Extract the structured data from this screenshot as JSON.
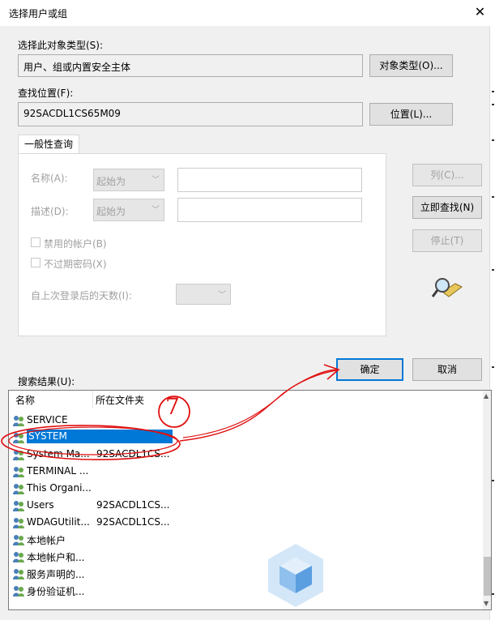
{
  "window": {
    "title": "选择用户或组",
    "close_glyph": "✕"
  },
  "object_type": {
    "label": "选择此对象类型(S):",
    "value": "用户、组或内置安全主体",
    "button": "对象类型(O)..."
  },
  "location": {
    "label": "查找位置(F):",
    "value": "92SACDL1CS65M09",
    "button": "位置(L)..."
  },
  "query": {
    "tab_label": "一般性查询",
    "name_label": "名称(A):",
    "name_mode": "起始为",
    "desc_label": "描述(D):",
    "desc_mode": "起始为",
    "disabled_accounts": "禁用的帐户(B)",
    "non_expiring_pw": "不过期密码(X)",
    "days_since_logon": "自上次登录后的天数(I):"
  },
  "side_buttons": {
    "columns": "列(C)...",
    "find_now": "立即查找(N)",
    "stop": "停止(T)"
  },
  "dialog_buttons": {
    "ok": "确定",
    "cancel": "取消"
  },
  "results": {
    "label": "搜索结果(U):",
    "col_name": "名称",
    "col_folder": "所在文件夹",
    "rows": [
      {
        "name": "SERVICE",
        "folder": ""
      },
      {
        "name": "SYSTEM",
        "folder": "",
        "selected": true
      },
      {
        "name": "System Ma...",
        "folder": "92SACDL1CS..."
      },
      {
        "name": "TERMINAL ...",
        "folder": ""
      },
      {
        "name": "This Organi...",
        "folder": ""
      },
      {
        "name": "Users",
        "folder": "92SACDL1CS..."
      },
      {
        "name": "WDAGUtilit...",
        "folder": "92SACDL1CS..."
      },
      {
        "name": "本地帐户",
        "folder": ""
      },
      {
        "name": "本地帐户和...",
        "folder": ""
      },
      {
        "name": "服务声明的...",
        "folder": ""
      },
      {
        "name": "身份验证机...",
        "folder": ""
      }
    ]
  },
  "annotation": {
    "step_number": "7",
    "color": "#e01010"
  },
  "icons": {
    "close": "close-icon",
    "search_glass": "magnifier-search-icon",
    "user_group": "user-group-icon",
    "watermark": "cube-logo-watermark"
  }
}
